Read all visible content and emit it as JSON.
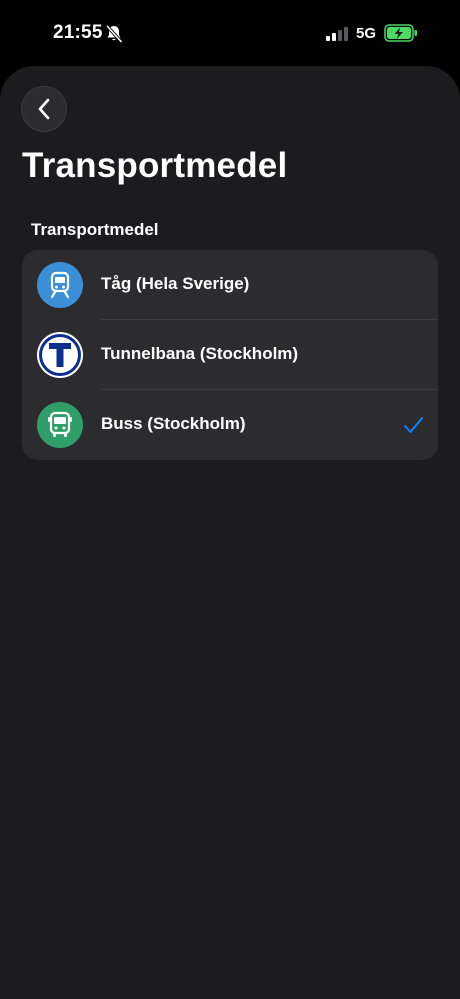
{
  "status_bar": {
    "time": "21:55",
    "network": "5G",
    "icons": [
      "bell-slash-icon",
      "cellular-signal-icon",
      "battery-charging-icon"
    ]
  },
  "header": {
    "back_icon": "chevron-left-icon",
    "title": "Transportmedel"
  },
  "section": {
    "header": "Transportmedel",
    "items": [
      {
        "label": "Tåg (Hela Sverige)",
        "icon": "train-icon",
        "icon_color": "#3a8fd6",
        "selected": false
      },
      {
        "label": "Tunnelbana (Stockholm)",
        "icon": "metro-t-icon",
        "icon_color": "#ffffff",
        "selected": false
      },
      {
        "label": "Buss (Stockholm)",
        "icon": "bus-icon",
        "icon_color": "#2f9e68",
        "selected": true
      }
    ]
  },
  "colors": {
    "background": "#1c1c1e",
    "group_background": "#2c2c2e",
    "accent": "#0a84ff",
    "metro_blue": "#0b2f8f"
  }
}
